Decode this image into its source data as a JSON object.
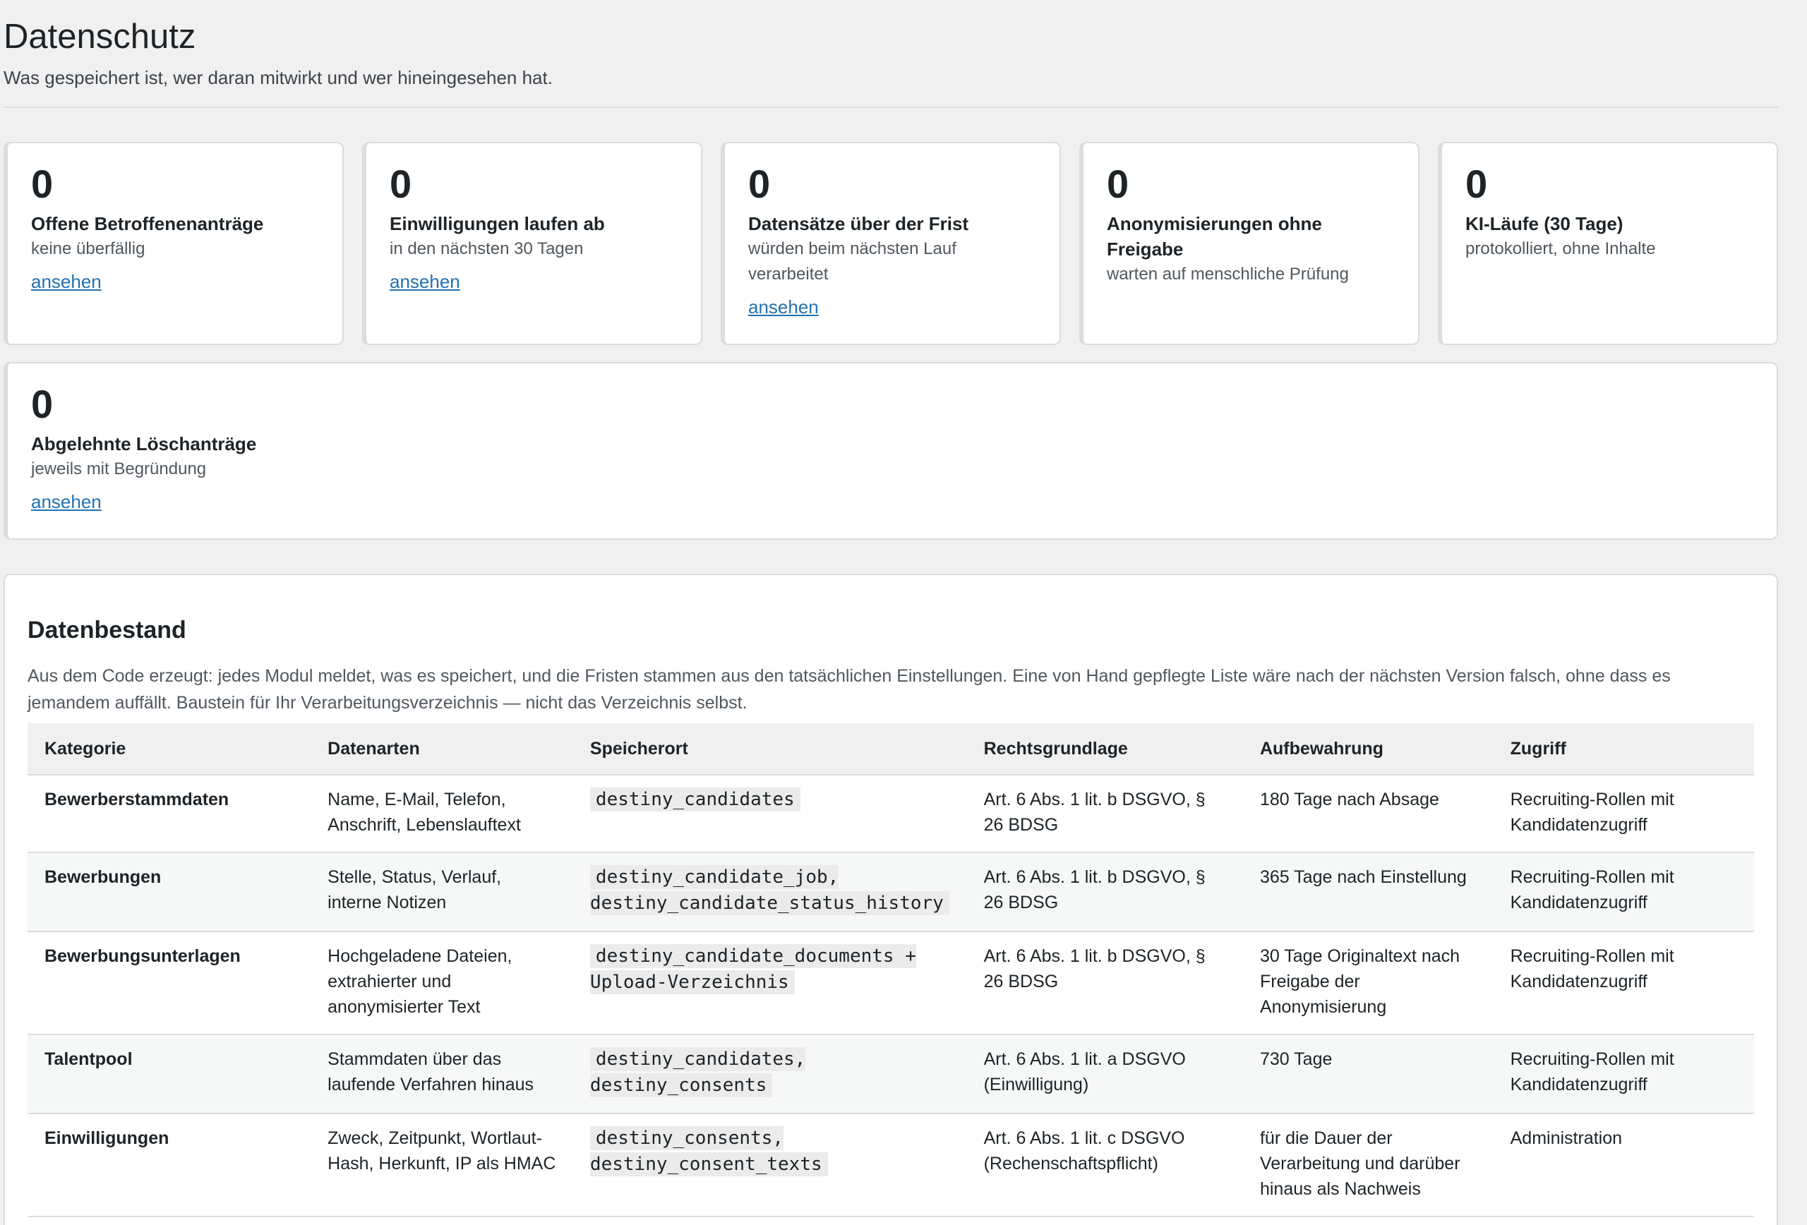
{
  "header": {
    "title": "Datenschutz",
    "subtitle": "Was gespeichert ist, wer daran mitwirkt und wer hineingesehen hat."
  },
  "cards": [
    {
      "value": "0",
      "title": "Offene Betroffenenanträge",
      "desc": "keine überfällig",
      "link": "ansehen"
    },
    {
      "value": "0",
      "title": "Einwilligungen laufen ab",
      "desc": "in den nächsten 30 Tagen",
      "link": "ansehen"
    },
    {
      "value": "0",
      "title": "Datensätze über der Frist",
      "desc": "würden beim nächsten Lauf verarbeitet",
      "link": "ansehen"
    },
    {
      "value": "0",
      "title": "Anonymisierungen ohne Freigabe",
      "desc": "warten auf menschliche Prüfung"
    },
    {
      "value": "0",
      "title": "KI-Läufe (30 Tage)",
      "desc": "protokolliert, ohne Inhalte"
    },
    {
      "value": "0",
      "title": "Abgelehnte Löschanträge",
      "desc": "jeweils mit Begründung",
      "link": "ansehen"
    }
  ],
  "inventory": {
    "title": "Datenbestand",
    "description": "Aus dem Code erzeugt: jedes Modul meldet, was es speichert, und die Fristen stammen aus den tatsächlichen Einstellungen. Eine von Hand gepflegte Liste wäre nach der nächsten Version falsch, ohne dass es jemandem auffällt. Baustein für Ihr Verarbeitungsverzeichnis — nicht das Verzeichnis selbst.",
    "columns": [
      "Kategorie",
      "Datenarten",
      "Speicherort",
      "Rechtsgrundlage",
      "Aufbewahrung",
      "Zugriff"
    ],
    "rows": [
      {
        "category": "Bewerberstammdaten",
        "data_types": "Name, E-Mail, Telefon, Anschrift, Lebenslauftext",
        "storage": "destiny_candidates",
        "legal_basis": "Art. 6 Abs. 1 lit. b DSGVO, § 26 BDSG",
        "retention": "180 Tage nach Absage",
        "access": "Recruiting-Rollen mit Kandidatenzugriff"
      },
      {
        "category": "Bewerbungen",
        "data_types": "Stelle, Status, Verlauf, interne Notizen",
        "storage": "destiny_candidate_job, destiny_candidate_status_history",
        "legal_basis": "Art. 6 Abs. 1 lit. b DSGVO, § 26 BDSG",
        "retention": "365 Tage nach Einstellung",
        "access": "Recruiting-Rollen mit Kandidatenzugriff"
      },
      {
        "category": "Bewerbungsunterlagen",
        "data_types": "Hochgeladene Dateien, extrahierter und anonymisierter Text",
        "storage": "destiny_candidate_documents + Upload-Verzeichnis",
        "legal_basis": "Art. 6 Abs. 1 lit. b DSGVO, § 26 BDSG",
        "retention": "30 Tage Originaltext nach Freigabe der Anonymisierung",
        "access": "Recruiting-Rollen mit Kandidatenzugriff"
      },
      {
        "category": "Talentpool",
        "data_types": "Stammdaten über das laufende Verfahren hinaus",
        "storage": "destiny_candidates, destiny_consents",
        "legal_basis": "Art. 6 Abs. 1 lit. a DSGVO (Einwilligung)",
        "retention": "730 Tage",
        "access": "Recruiting-Rollen mit Kandidatenzugriff"
      },
      {
        "category": "Einwilligungen",
        "data_types": "Zweck, Zeitpunkt, Wortlaut-Hash, Herkunft, IP als HMAC",
        "storage": "destiny_consents, destiny_consent_texts",
        "legal_basis": "Art. 6 Abs. 1 lit. c DSGVO (Rechenschaftspflicht)",
        "retention": "für die Dauer der Verarbeitung und darüber hinaus als Nachweis",
        "access": "Administration"
      }
    ]
  }
}
